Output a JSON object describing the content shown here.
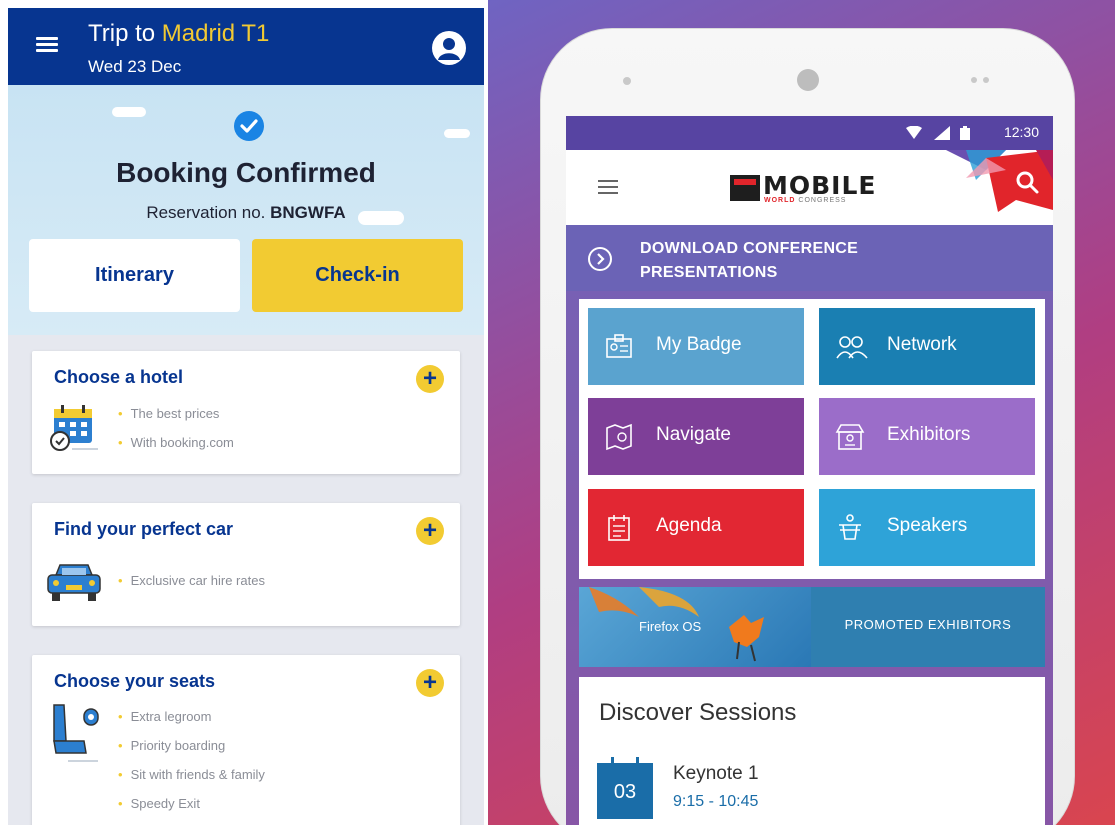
{
  "left_app": {
    "header": {
      "title_prefix": "Trip to",
      "destination": "Madrid T1",
      "date": "Wed 23 Dec",
      "menu_icon": "hamburger-icon",
      "profile_icon": "account-icon"
    },
    "booking": {
      "status": "Booking Confirmed",
      "reservation_label": "Reservation no.",
      "reservation_code": "BNGWFA",
      "itinerary_label": "Itinerary",
      "checkin_label": "Check-in"
    },
    "cards": [
      {
        "title": "Choose a hotel",
        "icon": "hotel-calendar-icon",
        "bullets": [
          "The best prices",
          "With booking.com"
        ]
      },
      {
        "title": "Find your perfect car",
        "icon": "car-icon",
        "bullets": [
          "Exclusive car hire rates"
        ]
      },
      {
        "title": "Choose your seats",
        "icon": "seat-icon",
        "bullets": [
          "Extra legroom",
          "Priority boarding",
          "Sit with friends & family",
          "Speedy Exit"
        ]
      }
    ],
    "colors": {
      "brand_blue": "#073590",
      "accent_yellow": "#f2cb32"
    }
  },
  "right_app": {
    "status_bar": {
      "time": "12:30"
    },
    "app_bar": {
      "logo_main": "MOBILE",
      "logo_sub_1": "WORLD",
      "logo_sub_2": "CONGRESS",
      "menu_icon": "hamburger-icon",
      "search_icon": "search-icon"
    },
    "download_banner": {
      "line1": "DOWNLOAD CONFERENCE",
      "line2": "PRESENTATIONS"
    },
    "tiles": [
      {
        "label": "My Badge",
        "icon": "badge-icon",
        "color": "#5aa3cf"
      },
      {
        "label": "Network",
        "icon": "people-icon",
        "color": "#1a7fb2"
      },
      {
        "label": "Navigate",
        "icon": "map-icon",
        "color": "#7e3f98"
      },
      {
        "label": "Exhibitors",
        "icon": "booth-icon",
        "color": "#9b6dc9"
      },
      {
        "label": "Agenda",
        "icon": "agenda-icon",
        "color": "#e22733"
      },
      {
        "label": "Speakers",
        "icon": "podium-icon",
        "color": "#2ea3d8"
      }
    ],
    "promo": {
      "left_label": "Firefox OS",
      "right_label": "PROMOTED EXHIBITORS"
    },
    "sessions": {
      "title": "Discover Sessions",
      "items": [
        {
          "day": "03",
          "name": "Keynote 1",
          "time": "9:15 - 10:45"
        }
      ]
    }
  }
}
